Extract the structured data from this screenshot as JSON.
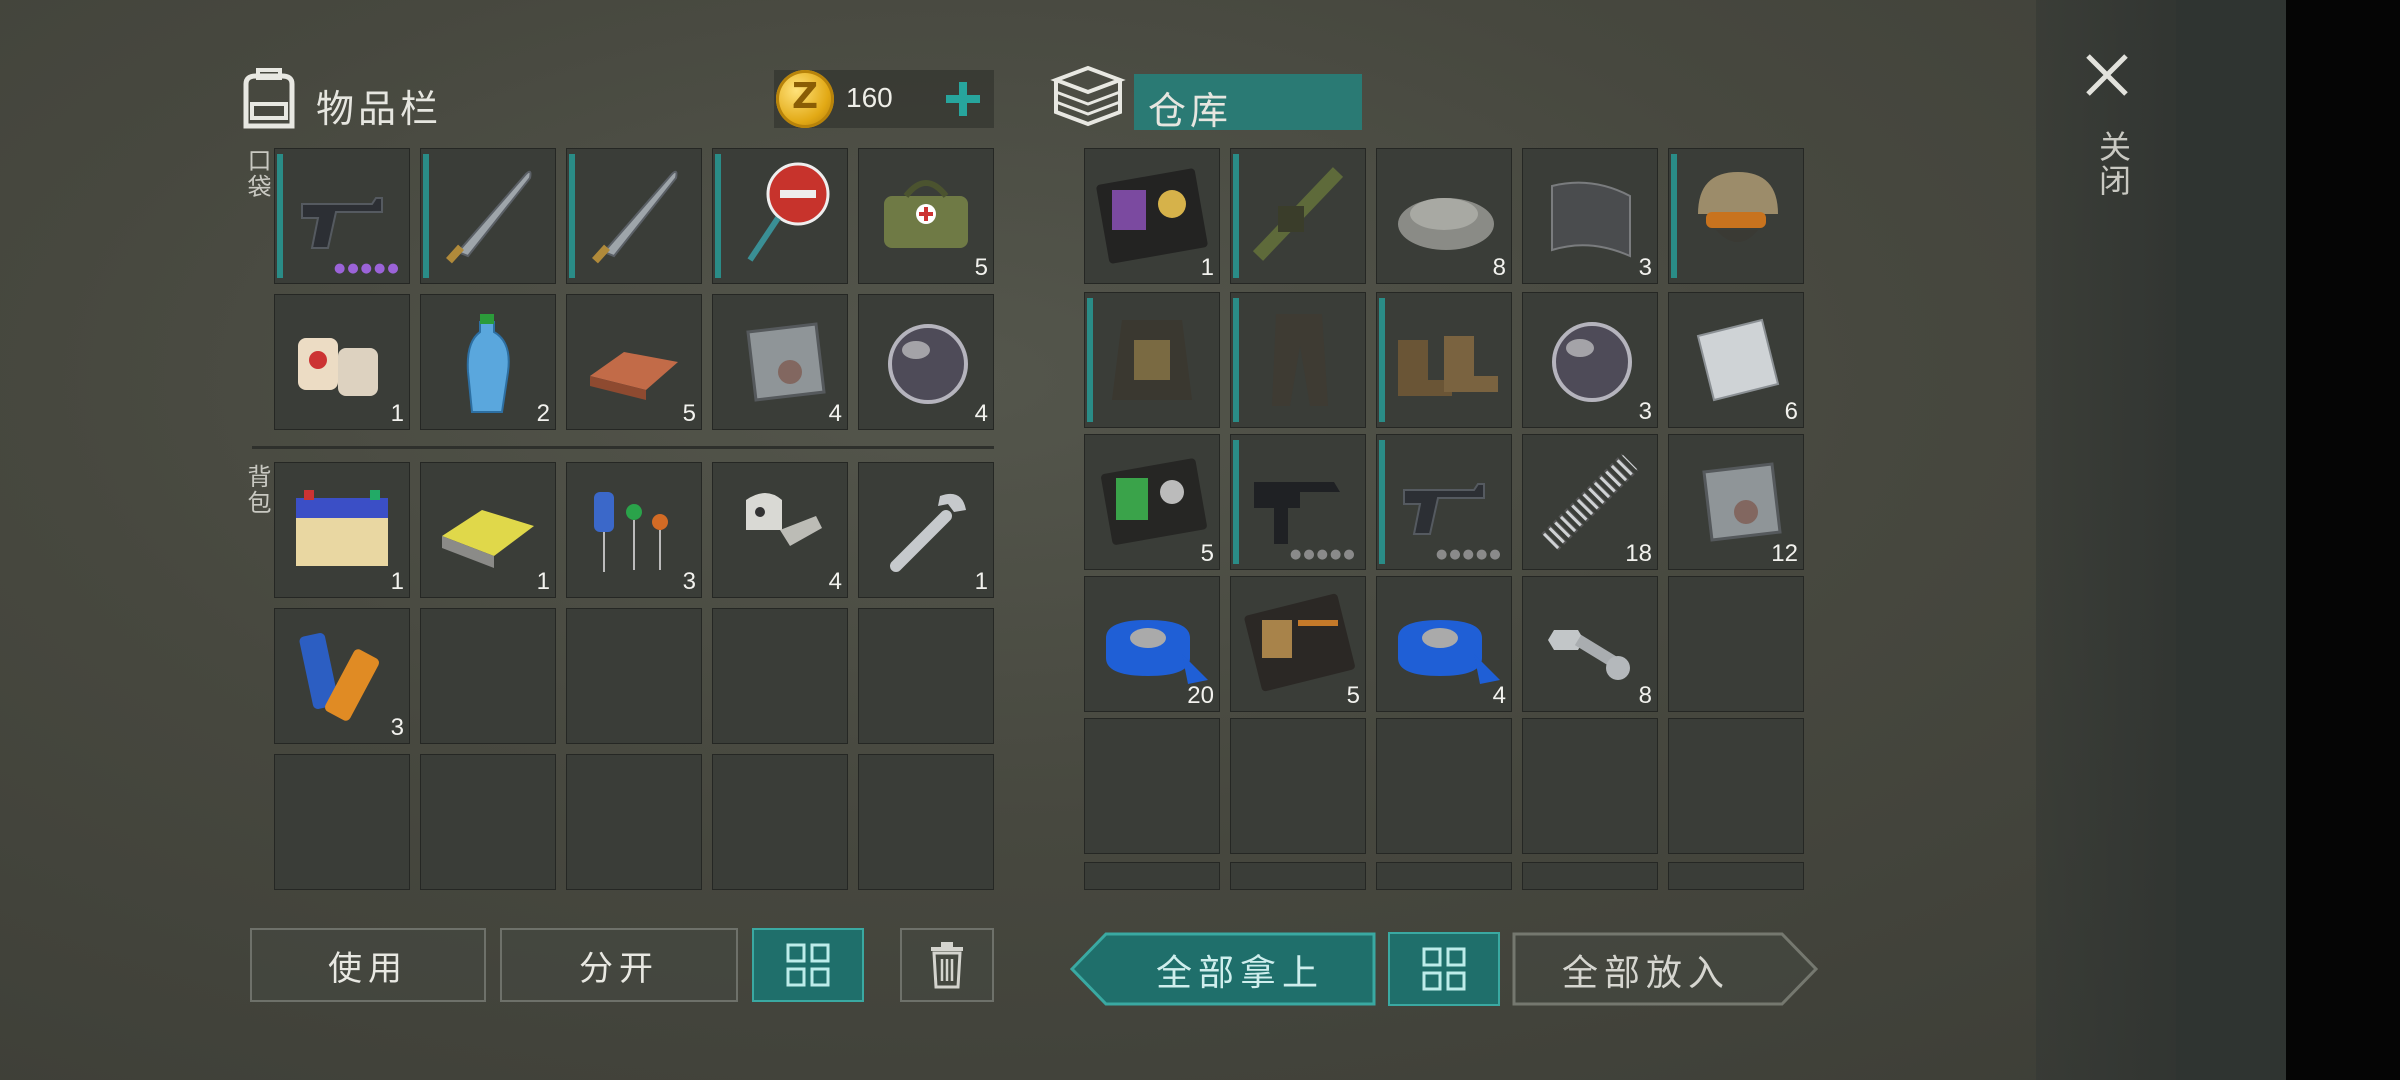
{
  "inventory": {
    "title": "物品栏",
    "coins": "160",
    "pockets_label": "口袋",
    "backpack_label": "背包",
    "pocket_slots": [
      {
        "item": "pistol",
        "count": "",
        "bar": true,
        "dots": "purple"
      },
      {
        "item": "katana",
        "count": "",
        "bar": true
      },
      {
        "item": "katana",
        "count": "",
        "bar": true
      },
      {
        "item": "stop-sign",
        "count": "",
        "bar": true
      },
      {
        "item": "medical-bag",
        "count": "5"
      },
      {
        "item": "bandage",
        "count": "1"
      },
      {
        "item": "water-bottle",
        "count": "2"
      },
      {
        "item": "copper-ingot",
        "count": "5"
      },
      {
        "item": "iron-plate",
        "count": "4"
      },
      {
        "item": "lens",
        "count": "4"
      }
    ],
    "backpack_slots": [
      {
        "item": "car-battery",
        "count": "1"
      },
      {
        "item": "power-bank",
        "count": "1"
      },
      {
        "item": "electronic-components",
        "count": "3"
      },
      {
        "item": "robot-parts",
        "count": "4"
      },
      {
        "item": "wrench",
        "count": "1"
      },
      {
        "item": "batteries",
        "count": "3"
      },
      {
        "item": "empty"
      },
      {
        "item": "empty"
      },
      {
        "item": "empty"
      },
      {
        "item": "empty"
      },
      {
        "item": "empty"
      },
      {
        "item": "empty"
      },
      {
        "item": "empty"
      },
      {
        "item": "empty"
      },
      {
        "item": "empty"
      }
    ],
    "buttons": {
      "use": "使用",
      "split": "分开"
    }
  },
  "storage": {
    "title": "仓库",
    "slots": [
      {
        "item": "police-badge",
        "count": "1"
      },
      {
        "item": "grenade-launcher",
        "count": "",
        "bar": true
      },
      {
        "item": "gravel",
        "count": "8"
      },
      {
        "item": "mesh-fabric",
        "count": "3"
      },
      {
        "item": "tactical-helmet",
        "count": "",
        "bar": true
      },
      {
        "item": "tactical-vest",
        "count": "",
        "bar": true
      },
      {
        "item": "tactical-pants",
        "count": "",
        "bar": true
      },
      {
        "item": "combat-boots",
        "count": "",
        "bar": true
      },
      {
        "item": "lens",
        "count": "3"
      },
      {
        "item": "steel-sheet",
        "count": "6"
      },
      {
        "item": "id-wallet",
        "count": "5"
      },
      {
        "item": "uzi",
        "count": "",
        "bar": true,
        "dots": "grey"
      },
      {
        "item": "pistol",
        "count": "",
        "bar": true,
        "dots": "grey"
      },
      {
        "item": "spring",
        "count": "18"
      },
      {
        "item": "iron-plate",
        "count": "12"
      },
      {
        "item": "duct-tape",
        "count": "20"
      },
      {
        "item": "officer-wallet",
        "count": "5"
      },
      {
        "item": "duct-tape",
        "count": "4"
      },
      {
        "item": "bolt-nut",
        "count": "8"
      },
      {
        "item": "empty"
      },
      {
        "item": "empty"
      },
      {
        "item": "empty"
      },
      {
        "item": "empty"
      },
      {
        "item": "empty"
      },
      {
        "item": "empty"
      }
    ],
    "buttons": {
      "take_all": "全部拿上",
      "put_all": "全部放入"
    }
  },
  "close_label": "关闭",
  "colors": {
    "accent": "#2a8c87",
    "button_teal": "#1f6f6b"
  }
}
